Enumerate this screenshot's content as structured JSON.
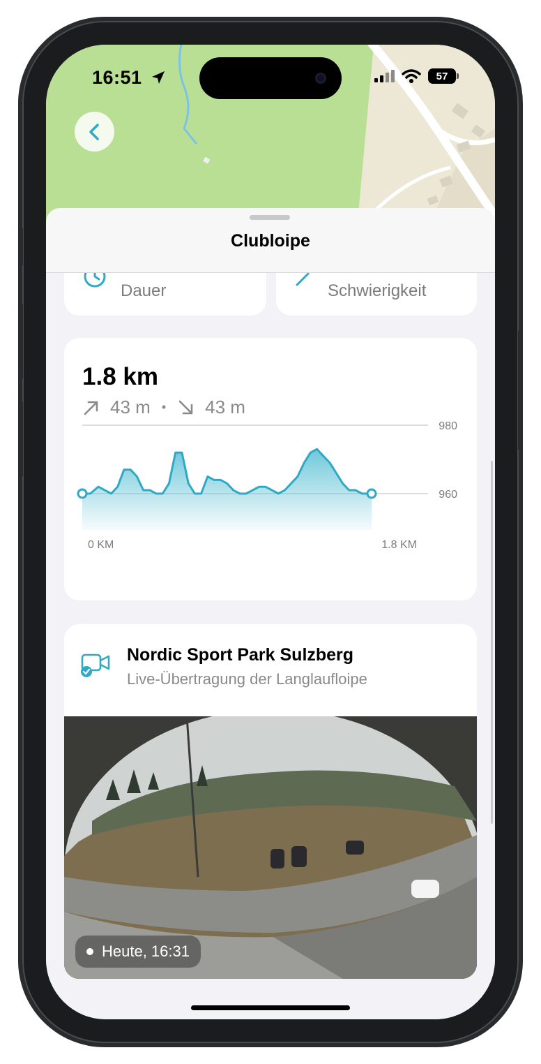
{
  "status_bar": {
    "time": "16:51",
    "battery": "57"
  },
  "sheet": {
    "title": "Clubloipe"
  },
  "stats": [
    {
      "label": "Dauer",
      "icon": "clock-icon"
    },
    {
      "label": "Schwierigkeit",
      "icon": "trend-up-icon"
    }
  ],
  "profile": {
    "distance": "1.8 km",
    "ascent": "43 m",
    "descent": "43 m",
    "separator": "•"
  },
  "chart_data": {
    "type": "area",
    "x_unit": "km",
    "xlim": [
      0,
      1.8
    ],
    "ylim": [
      950,
      980
    ],
    "y_ticks": [
      980,
      960
    ],
    "y_tick_labels": [
      "980",
      "960"
    ],
    "x_tick_labels": [
      "0 KM",
      "1.8 KM"
    ],
    "grid": true,
    "color": "#2fa9c4",
    "x": [
      0,
      0.05,
      0.1,
      0.14,
      0.18,
      0.22,
      0.26,
      0.3,
      0.34,
      0.38,
      0.42,
      0.46,
      0.5,
      0.54,
      0.58,
      0.62,
      0.66,
      0.7,
      0.74,
      0.78,
      0.82,
      0.86,
      0.9,
      0.94,
      0.98,
      1.02,
      1.06,
      1.1,
      1.14,
      1.18,
      1.22,
      1.26,
      1.3,
      1.34,
      1.38,
      1.42,
      1.46,
      1.5,
      1.54,
      1.58,
      1.62,
      1.66,
      1.7,
      1.74,
      1.8
    ],
    "y": [
      960,
      960,
      962,
      961,
      960,
      962,
      967,
      967,
      965,
      961,
      961,
      960,
      960,
      963,
      972,
      972,
      963,
      960,
      960,
      965,
      964,
      964,
      963,
      961,
      960,
      960,
      961,
      962,
      962,
      961,
      960,
      961,
      963,
      965,
      969,
      972,
      973,
      971,
      969,
      966,
      963,
      961,
      961,
      960,
      960
    ]
  },
  "webcam": {
    "title": "Nordic Sport Park Sulzberg",
    "subtitle": "Live-Übertragung der Langlaufloipe",
    "timestamp": "Heute, 16:31"
  }
}
